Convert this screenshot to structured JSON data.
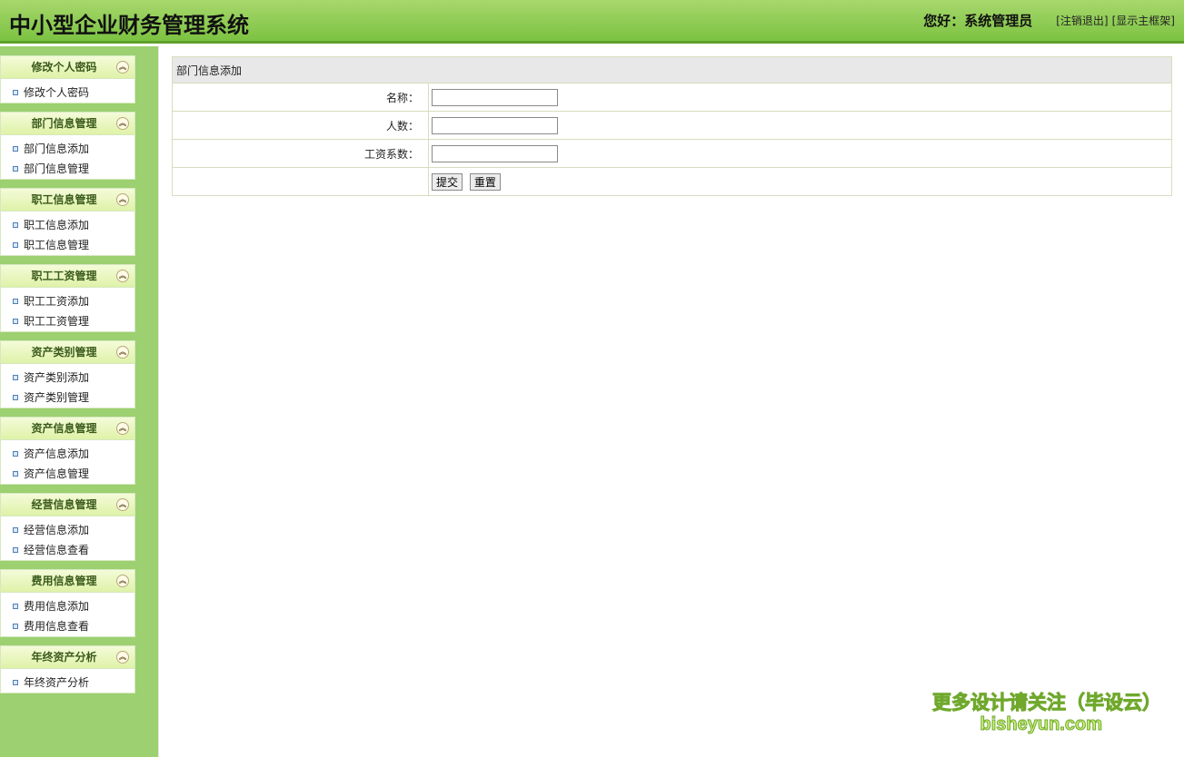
{
  "header": {
    "app_title": "中小型企业财务管理系统",
    "greeting": "您好：系统管理员",
    "logout_link": "[注销退出]",
    "show_frame_link": "[显示主框架]"
  },
  "sidebar": {
    "groups": [
      {
        "title": "修改个人密码",
        "items": [
          "修改个人密码"
        ]
      },
      {
        "title": "部门信息管理",
        "items": [
          "部门信息添加",
          "部门信息管理"
        ]
      },
      {
        "title": "职工信息管理",
        "items": [
          "职工信息添加",
          "职工信息管理"
        ]
      },
      {
        "title": "职工工资管理",
        "items": [
          "职工工资添加",
          "职工工资管理"
        ]
      },
      {
        "title": "资产类别管理",
        "items": [
          "资产类别添加",
          "资产类别管理"
        ]
      },
      {
        "title": "资产信息管理",
        "items": [
          "资产信息添加",
          "资产信息管理"
        ]
      },
      {
        "title": "经营信息管理",
        "items": [
          "经营信息添加",
          "经营信息查看"
        ]
      },
      {
        "title": "费用信息管理",
        "items": [
          "费用信息添加",
          "费用信息查看"
        ]
      },
      {
        "title": "年终资产分析",
        "items": [
          "年终资产分析"
        ]
      }
    ],
    "collapse_glyph": "︽"
  },
  "form": {
    "caption": "部门信息添加",
    "fields": [
      {
        "label": "名称：",
        "value": ""
      },
      {
        "label": "人数：",
        "value": ""
      },
      {
        "label": "工资系数：",
        "value": ""
      }
    ],
    "submit_label": "提交",
    "reset_label": "重置"
  },
  "watermark": {
    "line1": "更多设计请关注（毕设云）",
    "line2": "bisheyun.com"
  },
  "colors": {
    "header_green": "#7cc242",
    "sidebar_green": "#9cd070"
  }
}
